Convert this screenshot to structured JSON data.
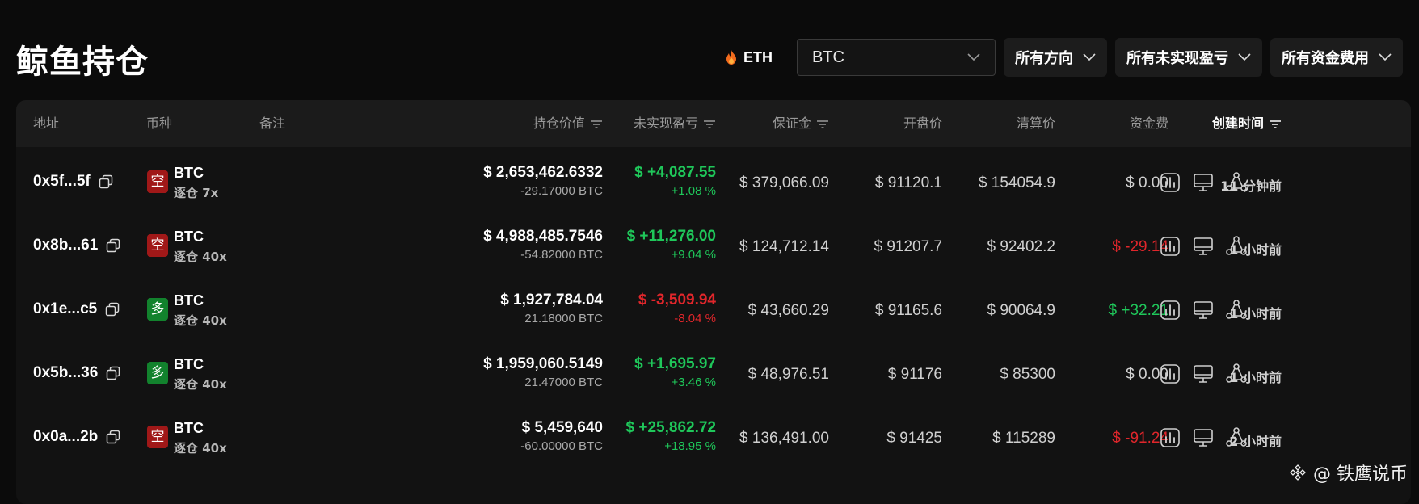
{
  "page": {
    "title": "鲸鱼持仓"
  },
  "toolbar": {
    "eth_label": "ETH",
    "coin_select_value": "BTC",
    "filter_direction": "所有方向",
    "filter_pnl": "所有未实现盈亏",
    "filter_funding": "所有资金费用"
  },
  "table": {
    "headers": {
      "address": "地址",
      "coin": "币种",
      "note": "备注",
      "position_value": "持仓价值",
      "unrealized_pnl": "未实现盈亏",
      "margin": "保证金",
      "entry_price": "开盘价",
      "liq_price": "清算价",
      "funding": "资金费",
      "created": "创建时间"
    },
    "rows": [
      {
        "address": "0x5f...5f",
        "side": "空",
        "side_type": "short",
        "coin": "BTC",
        "leverage": "逐仓 7x",
        "value": "$ 2,653,462.6332",
        "size": "-29.17000 BTC",
        "pnl": "$ +4,087.55",
        "pnl_pct": "+1.08 %",
        "pnl_sign": "pos",
        "margin": "$ 379,066.09",
        "entry": "$ 91120.1",
        "liq": "$ 154054.9",
        "funding": "$ 0.00",
        "funding_sign": "zero",
        "time": "11 分钟前"
      },
      {
        "address": "0x8b...61",
        "side": "空",
        "side_type": "short",
        "coin": "BTC",
        "leverage": "逐仓 40x",
        "value": "$ 4,988,485.7546",
        "size": "-54.82000 BTC",
        "pnl": "$ +11,276.00",
        "pnl_pct": "+9.04 %",
        "pnl_sign": "pos",
        "margin": "$ 124,712.14",
        "entry": "$ 91207.7",
        "liq": "$ 92402.2",
        "funding": "$ -29.14",
        "funding_sign": "neg",
        "time": "1 小时前"
      },
      {
        "address": "0x1e...c5",
        "side": "多",
        "side_type": "long",
        "coin": "BTC",
        "leverage": "逐仓 40x",
        "value": "$ 1,927,784.04",
        "size": "21.18000 BTC",
        "pnl": "$ -3,509.94",
        "pnl_pct": "-8.04 %",
        "pnl_sign": "neg",
        "margin": "$ 43,660.29",
        "entry": "$ 91165.6",
        "liq": "$ 90064.9",
        "funding": "$ +32.21",
        "funding_sign": "pos",
        "time": "1 小时前"
      },
      {
        "address": "0x5b...36",
        "side": "多",
        "side_type": "long",
        "coin": "BTC",
        "leverage": "逐仓 40x",
        "value": "$ 1,959,060.5149",
        "size": "21.47000 BTC",
        "pnl": "$ +1,695.97",
        "pnl_pct": "+3.46 %",
        "pnl_sign": "pos",
        "margin": "$ 48,976.51",
        "entry": "$ 91176",
        "liq": "$ 85300",
        "funding": "$ 0.00",
        "funding_sign": "zero",
        "time": "1 小时前"
      },
      {
        "address": "0x0a...2b",
        "side": "空",
        "side_type": "short",
        "coin": "BTC",
        "leverage": "逐仓 40x",
        "value": "$ 5,459,640",
        "size": "-60.00000 BTC",
        "pnl": "$ +25,862.72",
        "pnl_pct": "+18.95 %",
        "pnl_sign": "pos",
        "margin": "$ 136,491.00",
        "entry": "$ 91425",
        "liq": "$ 115289",
        "funding": "$ -91.24",
        "funding_sign": "neg",
        "time": "2 小时前"
      }
    ]
  },
  "watermark": {
    "text": "@ 铁鹰说币"
  },
  "colors": {
    "positive": "#1fc75a",
    "negative": "#e0262b",
    "short_badge": "#a01818",
    "long_badge": "#12822d"
  }
}
